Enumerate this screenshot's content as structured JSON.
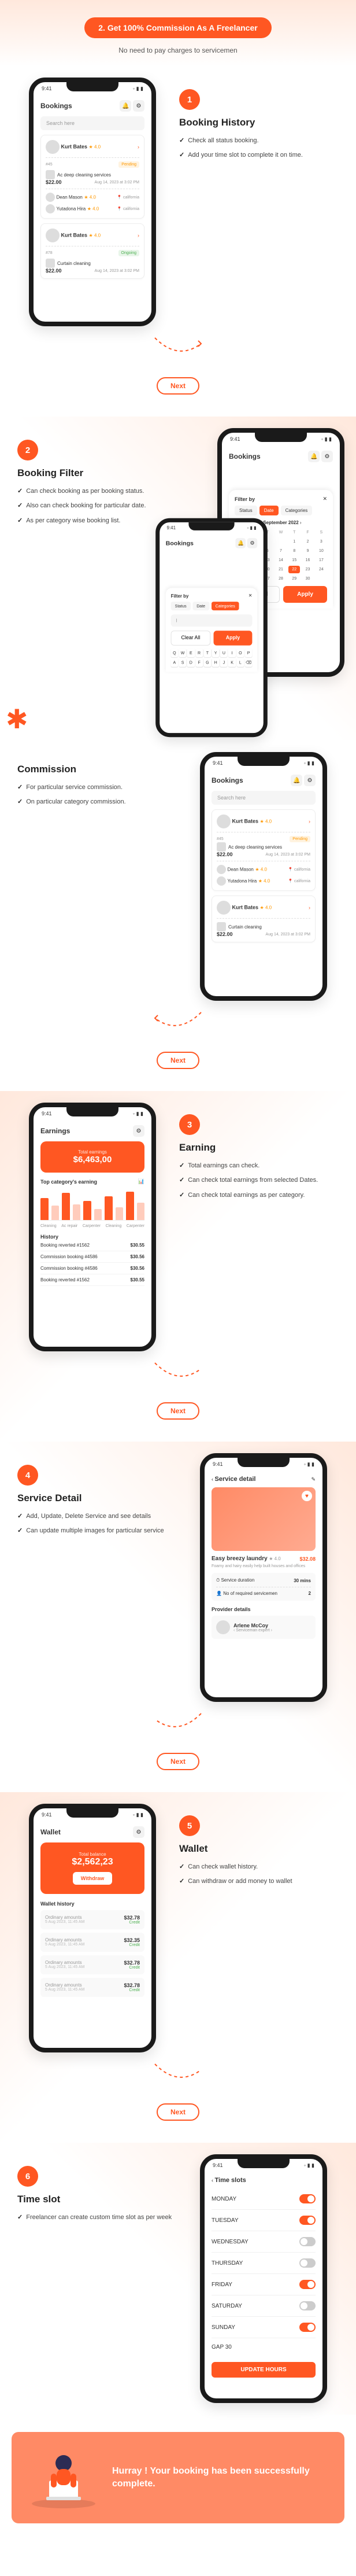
{
  "header": {
    "pill": "2. Get 100% Commission As A Freelancer",
    "sub": "No need to pay charges to servicemen"
  },
  "next_label": "Next",
  "sections": [
    {
      "num": "1",
      "title": "Booking History",
      "items": [
        "Check all status booking.",
        "Add your time slot to complete it on time."
      ]
    },
    {
      "num": "2",
      "title": "Booking Filter",
      "items": [
        "Can check booking as per booking status.",
        "Also can check booking for particular date.",
        "As per category wise booking list."
      ]
    },
    {
      "num": "",
      "title": "Commission",
      "items": [
        "For particular service commission.",
        "On particular category commission."
      ]
    },
    {
      "num": "3",
      "title": "Earning",
      "items": [
        "Total earnings can check.",
        "Can check total earnings from selected Dates.",
        "Can check total earnings as per category."
      ]
    },
    {
      "num": "4",
      "title": "Service Detail",
      "items": [
        "Add, Update, Delete Service and see details",
        "Can update multiple images for particular service"
      ]
    },
    {
      "num": "5",
      "title": "Wallet",
      "items": [
        "Can check wallet history.",
        "Can withdraw or add money to wallet"
      ]
    },
    {
      "num": "6",
      "title": "Time slot",
      "items": [
        "Freelancer can create custom time slot as per week"
      ]
    }
  ],
  "phone": {
    "time": "9:41",
    "icons": "◦ ▮ ▮",
    "bookings_title": "Bookings",
    "search": "Search here",
    "user1": "Kurt Bates",
    "star": "★ 4.0",
    "status_pending": "Pending",
    "status_ongoing": "Ongoing",
    "service1": "Ac deep cleaning services",
    "price1": "$22.00",
    "date1": "Aug 14, 2023 at 3:02 PM",
    "dean": "Dean Mason",
    "dean_star": "★ 4.0",
    "dean_loc": "california",
    "yut": "Yutadona Hira",
    "yut_star": "★ 4.0",
    "service2": "Curtain cleaning",
    "filter_title": "Filter by",
    "filter_status": "Status",
    "filter_date": "Date",
    "filter_cat": "Categories",
    "month": "September 2022",
    "clear": "Clear All",
    "apply": "Apply",
    "earnings_title": "Earnings",
    "total_label": "Total earnings",
    "total_amount": "$6,463,00",
    "top_cat": "Top category's earning",
    "cleaning": "Cleaning",
    "ac_repair": "Ac repair",
    "carpenter": "Carpenter",
    "history_label": "History",
    "hist1": "Booking reverted #1562",
    "hist1_amt": "$30.55",
    "hist2": "Commission booking #4586",
    "hist2_amt": "$30.56",
    "service_detail_title": "Service detail",
    "sd_name": "Easy breezy laundry",
    "sd_star": "★ 4.0",
    "sd_price": "$32.08",
    "sd_desc": "Foamy and hairy easily help built houses and offices",
    "sd_dur": "Service duration",
    "sd_dur_v": "30 mins",
    "sd_area": "No of required servicemen",
    "sd_prov": "Provider details",
    "prov_name": "Arlene McCoy",
    "prov_sub": "‹ Serviceman expert ›",
    "wallet_title": "Wallet",
    "wallet_bal_label": "Total balance",
    "wallet_bal": "$2,562,23",
    "withdraw": "Withdraw",
    "wallet_hist": "Wallet history",
    "wh_sub": "Ordinary amounts",
    "wh_amt": "$32.78",
    "wh_amt2": "$32.35",
    "wh_date": "5 Aug 2023, 11:45 AM",
    "wh_credit": "Credit",
    "ts_title": "Time slots",
    "days": [
      "MONDAY",
      "TUESDAY",
      "WEDNESDAY",
      "THURSDAY",
      "FRIDAY",
      "SATURDAY",
      "SUNDAY"
    ],
    "gap": "GAP     30",
    "update": "UPDATE HOURS"
  },
  "footer": "Hurray ! Your booking has been successfully complete."
}
